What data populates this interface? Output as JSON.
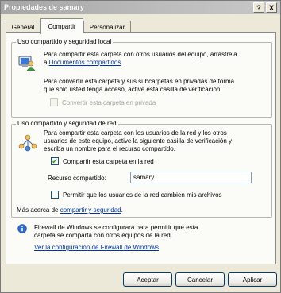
{
  "window": {
    "title": "Propiedades de samary",
    "help_button": "?",
    "close_button": "X"
  },
  "tabs": [
    {
      "label": "General"
    },
    {
      "label": "Compartir"
    },
    {
      "label": "Personalizar"
    }
  ],
  "local_group": {
    "legend": "Uso compartido y seguridad local",
    "line1": "Para compartir esta carpeta con otros usuarios del equipo, arrástrela",
    "line2_prefix": "a ",
    "line2_link": "Documentos compartidos",
    "line2_suffix": ".",
    "para2_line1": "Para convertir esta carpeta y sus subcarpetas en privadas de forma",
    "para2_line2": "que sólo usted tenga acceso, active esta casilla de verificación.",
    "make_private_label": "Convertir esta carpeta en privada",
    "make_private_checked": false
  },
  "network_group": {
    "legend": "Uso compartido y seguridad de red",
    "line1": "Para compartir esta carpeta con los usuarios de la red y los otros",
    "line2": "usuarios de este equipo, active la siguiente casilla de verificación y",
    "line3": "escriba un nombre para el recurso compartido.",
    "share_label": "Compartir esta carpeta en la red",
    "share_checked": "✔",
    "share_name_label": "Recurso compartido:",
    "share_name_value": "samary",
    "allow_change_label": "Permitir que los usuarios de la red cambien mis archivos",
    "allow_change_checked": false,
    "more_prefix": "Más acerca de ",
    "more_link": "compartir y seguridad",
    "more_suffix": "."
  },
  "firewall": {
    "line1": "Firewall de Windows se configurará para permitir que esta",
    "line2": "carpeta se comparta con otros equipos de la red.",
    "link": "Ver la configuración de Firewall de Windows"
  },
  "buttons": {
    "ok": "Aceptar",
    "cancel": "Cancelar",
    "apply": "Aplicar"
  },
  "colors": {
    "link": "#0034a8",
    "dialog_bg": "#ece9d8",
    "panel_bg": "#fbfbf8"
  }
}
